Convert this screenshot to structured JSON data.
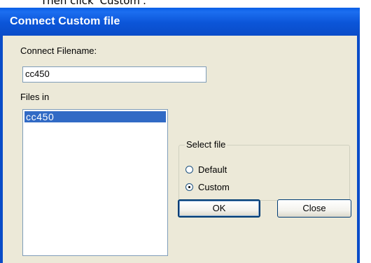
{
  "caption": "Then click 'Custom'.",
  "dialog": {
    "title": "Connect Custom file",
    "filename_label": "Connect Filename:",
    "filename_value": "cc450",
    "files_label": "Files in",
    "files": [
      {
        "name": "cc450",
        "selected": true
      }
    ],
    "select_group": {
      "legend": "Select file",
      "options": [
        {
          "label": "Default",
          "checked": false
        },
        {
          "label": "Custom",
          "checked": true
        }
      ]
    },
    "ok_label": "OK",
    "close_label": "Close"
  },
  "colors": {
    "title_bar": "#0a4cc8",
    "face": "#ece9d8",
    "selection": "#316ac5"
  }
}
